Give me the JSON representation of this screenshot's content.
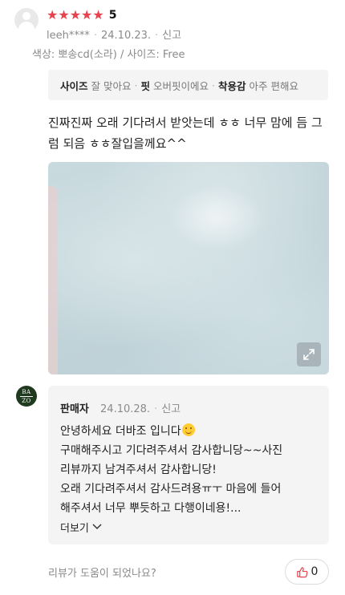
{
  "review": {
    "rating_stars": 5,
    "rating_value": "5",
    "username": "leeh****",
    "date": "24.10.23.",
    "report_label": "신고",
    "option_text": "색상: 뽀송cd(소라) / 사이즈: Free",
    "survey": [
      {
        "key": "사이즈",
        "value": "잘 맞아요"
      },
      {
        "key": "핏",
        "value": "오버핏이에요"
      },
      {
        "key": "착용감",
        "value": "아주 편해요"
      }
    ],
    "content_line1": "진짜진짜 오래 기다려서 받앗는데 ㅎㅎ 너무 맘에 듬 그",
    "content_line2": "럼 되음 ㅎㅎ잘입을께요^^",
    "colors": {
      "star": "#e8424d",
      "muted": "#8a8a8a",
      "panel": "#f4f4f4"
    }
  },
  "seller_reply": {
    "logo_top": "BA",
    "logo_bottom": "ZO",
    "seller_label": "판매자",
    "date": "24.10.28.",
    "report_label": "신고",
    "lines": [
      "안녕하세요 더바조 입니다",
      "구매해주시고 기다려주셔서 감사합니당~~사진",
      "리뷰까지 남겨주셔서 감사합니당!",
      "오래 기다려주셔서 감사드려용ㅠㅜ 마음에 들어",
      "해주셔서 너무 뿌듯하고 다행이네용!..."
    ],
    "more_label": "더보기"
  },
  "footer": {
    "helpful_question": "리뷰가 도움이 되었나요?",
    "helpful_count": "0"
  },
  "icons": [
    "user-avatar-icon",
    "star-icon",
    "expand-icon",
    "chevron-down-icon",
    "thumbs-up-icon",
    "smiley-emoji-icon"
  ]
}
